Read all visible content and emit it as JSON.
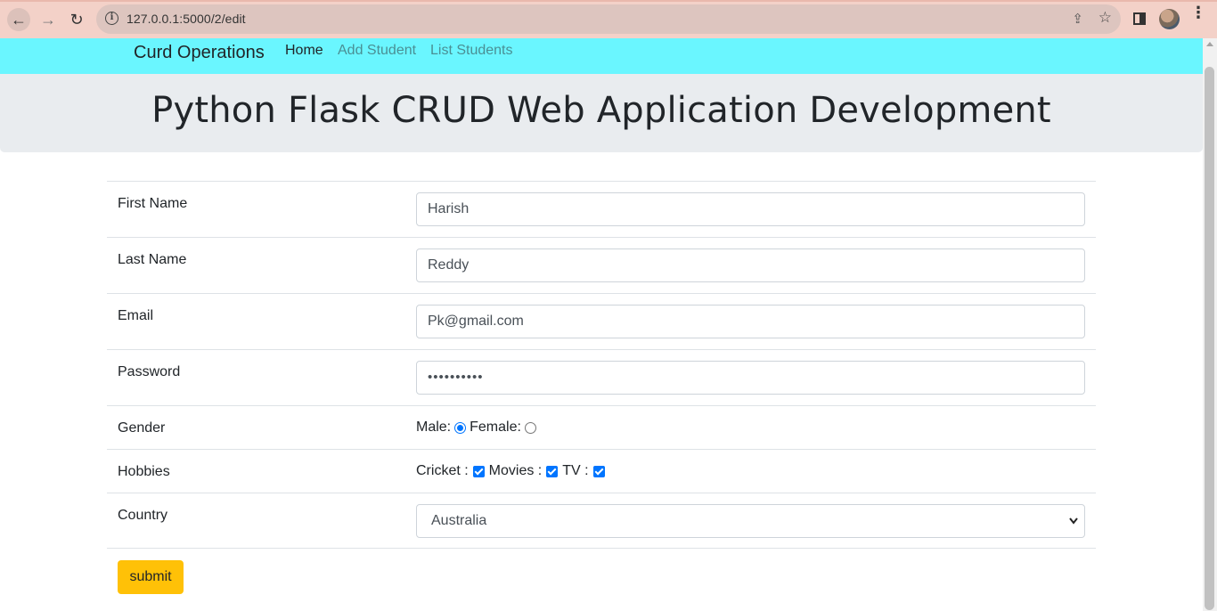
{
  "browser": {
    "url": "127.0.0.1:5000/2/edit",
    "back_icon": "←",
    "forward_icon": "→",
    "reload_icon": "↻",
    "share_icon": "⇪",
    "star_icon": "☆",
    "info_icon": "i",
    "menu_icon": "⋮"
  },
  "navbar": {
    "brand": "Curd Operations",
    "links": [
      {
        "label": "Home",
        "active": true
      },
      {
        "label": "Add Student",
        "active": false
      },
      {
        "label": "List Students",
        "active": false
      }
    ]
  },
  "header": {
    "title": "Python Flask CRUD Web Application Development"
  },
  "form": {
    "first_name_label": "First Name",
    "first_name_value": "Harish",
    "last_name_label": "Last Name",
    "last_name_value": "Reddy",
    "email_label": "Email",
    "email_value": "Pk@gmail.com",
    "password_label": "Password",
    "password_value": "••••••••••",
    "gender_label": "Gender",
    "gender_male": "Male:",
    "gender_female": "Female:",
    "gender_selected": "Male",
    "hobbies_label": "Hobbies",
    "hobby_cricket": "Cricket :",
    "hobby_movies": "Movies :",
    "hobby_tv": "TV :",
    "country_label": "Country",
    "country_value": "Australia",
    "submit_label": "submit"
  },
  "colors": {
    "navbar_bg": "#6af6ff",
    "jumbotron_bg": "#e9ecef",
    "submit_bg": "#ffc107",
    "chrome_bg": "#f3d1c8",
    "control_accent": "#0075ff"
  }
}
